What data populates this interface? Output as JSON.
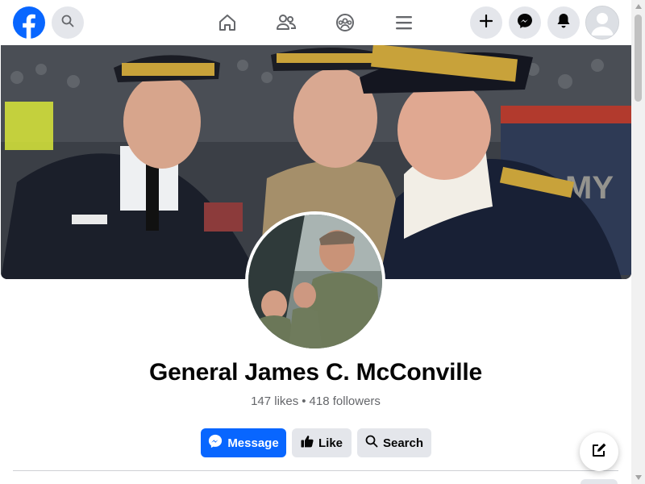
{
  "app": {
    "brand": "Facebook",
    "brand_color": "#0866ff"
  },
  "header": {
    "icons": [
      "facebook-logo",
      "search-icon",
      "home-icon",
      "friends-icon",
      "groups-icon",
      "menu-icon",
      "plus-icon",
      "messenger-icon",
      "bell-icon",
      "avatar"
    ]
  },
  "profile": {
    "name": "General James C. McConville",
    "likes": "147 likes",
    "separator": "•",
    "followers": "418 followers"
  },
  "actions": {
    "message_label": "Message",
    "like_label": "Like",
    "search_label": "Search"
  },
  "colors": {
    "primary_button": "#0866ff",
    "secondary_button": "#e4e6eb",
    "secondary_text": "#65676b"
  }
}
